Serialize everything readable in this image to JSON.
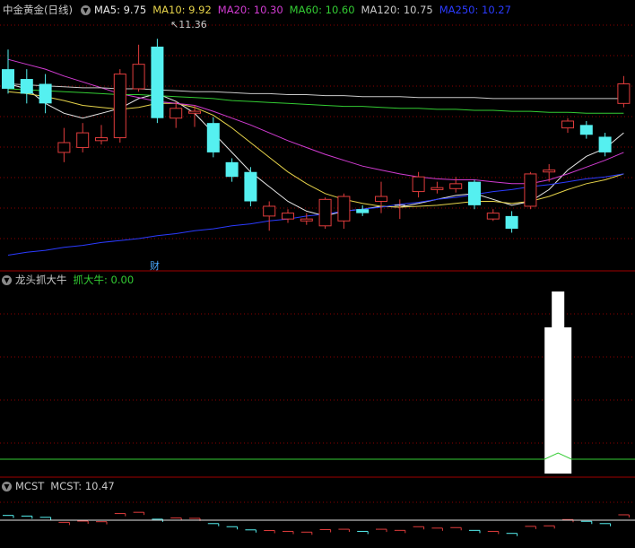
{
  "main_panel": {
    "title": "中金黄金(日线)",
    "ma_items": [
      {
        "label": "MA5: 9.75",
        "color": "#e8e8e8"
      },
      {
        "label": "MA10: 9.92",
        "color": "#e6d34a"
      },
      {
        "label": "MA20: 10.30",
        "color": "#d23cd2"
      },
      {
        "label": "MA60: 10.60",
        "color": "#33cc33"
      },
      {
        "label": "MA120: 10.75",
        "color": "#c8c8c8"
      },
      {
        "label": "MA250: 10.27",
        "color": "#2b3bff"
      }
    ],
    "max_price_label": "11.36",
    "marker_label": "财"
  },
  "indicator_panel": {
    "title": "龙头抓大牛",
    "value_label": "抓大牛: 0.00",
    "value_color": "#33cc33"
  },
  "mcst_panel": {
    "title": "MCST",
    "value_label": "MCST: 10.47"
  },
  "colors": {
    "up": "#e03c3c",
    "down": "#55f0f0",
    "grid": "#8b0000",
    "divider": "#a00000"
  },
  "chart_data": {
    "type": "candlestick",
    "price_axis_approx": [
      9.1,
      11.5
    ],
    "candles": [
      {
        "o": 11.05,
        "c": 10.85,
        "h": 11.25,
        "l": 10.8
      },
      {
        "o": 10.95,
        "c": 10.8,
        "h": 11.05,
        "l": 10.7
      },
      {
        "o": 10.9,
        "c": 10.7,
        "h": 11.0,
        "l": 10.6
      },
      {
        "o": 10.2,
        "c": 10.3,
        "h": 10.45,
        "l": 10.1
      },
      {
        "o": 10.25,
        "c": 10.4,
        "h": 10.5,
        "l": 10.2
      },
      {
        "o": 10.32,
        "c": 10.35,
        "h": 10.48,
        "l": 10.28
      },
      {
        "o": 10.35,
        "c": 11.0,
        "h": 11.05,
        "l": 10.3
      },
      {
        "o": 10.85,
        "c": 11.1,
        "h": 11.3,
        "l": 10.82
      },
      {
        "o": 11.28,
        "c": 10.55,
        "h": 11.36,
        "l": 10.5
      },
      {
        "o": 10.55,
        "c": 10.65,
        "h": 10.72,
        "l": 10.45
      },
      {
        "o": 10.6,
        "c": 10.62,
        "h": 10.68,
        "l": 10.46
      },
      {
        "o": 10.5,
        "c": 10.2,
        "h": 10.56,
        "l": 10.15
      },
      {
        "o": 10.1,
        "c": 9.95,
        "h": 10.14,
        "l": 9.9
      },
      {
        "o": 10.0,
        "c": 9.7,
        "h": 10.05,
        "l": 9.65
      },
      {
        "o": 9.55,
        "c": 9.65,
        "h": 9.7,
        "l": 9.4
      },
      {
        "o": 9.52,
        "c": 9.58,
        "h": 9.62,
        "l": 9.48
      },
      {
        "o": 9.5,
        "c": 9.52,
        "h": 9.58,
        "l": 9.46
      },
      {
        "o": 9.45,
        "c": 9.72,
        "h": 9.74,
        "l": 9.42
      },
      {
        "o": 9.5,
        "c": 9.75,
        "h": 9.78,
        "l": 9.42
      },
      {
        "o": 9.62,
        "c": 9.58,
        "h": 9.66,
        "l": 9.55
      },
      {
        "o": 9.7,
        "c": 9.75,
        "h": 9.9,
        "l": 9.58
      },
      {
        "o": 9.65,
        "c": 9.66,
        "h": 9.72,
        "l": 9.52
      },
      {
        "o": 9.8,
        "c": 9.95,
        "h": 10.0,
        "l": 9.74
      },
      {
        "o": 9.82,
        "c": 9.84,
        "h": 9.9,
        "l": 9.78
      },
      {
        "o": 9.83,
        "c": 9.88,
        "h": 9.95,
        "l": 9.79
      },
      {
        "o": 9.9,
        "c": 9.66,
        "h": 9.92,
        "l": 9.62
      },
      {
        "o": 9.52,
        "c": 9.58,
        "h": 9.62,
        "l": 9.5
      },
      {
        "o": 9.55,
        "c": 9.42,
        "h": 9.6,
        "l": 9.38
      },
      {
        "o": 9.65,
        "c": 9.98,
        "h": 10.0,
        "l": 9.62
      },
      {
        "o": 10.0,
        "c": 10.02,
        "h": 10.08,
        "l": 9.9
      },
      {
        "o": 10.45,
        "c": 10.52,
        "h": 10.55,
        "l": 10.4
      },
      {
        "o": 10.48,
        "c": 10.38,
        "h": 10.52,
        "l": 10.34
      },
      {
        "o": 10.36,
        "c": 10.2,
        "h": 10.4,
        "l": 10.16
      },
      {
        "o": 10.7,
        "c": 10.9,
        "h": 10.98,
        "l": 10.66
      }
    ],
    "ma_lines": {
      "ma5": [
        10.9,
        10.85,
        10.7,
        10.6,
        10.55,
        10.6,
        10.65,
        10.75,
        10.8,
        10.72,
        10.6,
        10.4,
        10.2,
        10.0,
        9.85,
        9.7,
        9.6,
        9.55,
        9.6,
        9.62,
        9.65,
        9.64,
        9.68,
        9.72,
        9.76,
        9.78,
        9.72,
        9.66,
        9.7,
        9.82,
        10.02,
        10.16,
        10.24,
        10.4
      ],
      "ma10": [
        10.82,
        10.8,
        10.77,
        10.73,
        10.68,
        10.66,
        10.64,
        10.66,
        10.7,
        10.7,
        10.66,
        10.58,
        10.45,
        10.3,
        10.15,
        10.0,
        9.88,
        9.78,
        9.72,
        9.68,
        9.65,
        9.64,
        9.65,
        9.66,
        9.68,
        9.7,
        9.7,
        9.68,
        9.7,
        9.75,
        9.82,
        9.88,
        9.92,
        9.98
      ],
      "ma20": [
        11.15,
        11.1,
        11.05,
        10.98,
        10.92,
        10.86,
        10.8,
        10.76,
        10.72,
        10.7,
        10.68,
        10.62,
        10.55,
        10.48,
        10.4,
        10.32,
        10.25,
        10.18,
        10.12,
        10.06,
        10.02,
        9.98,
        9.95,
        9.93,
        9.92,
        9.92,
        9.9,
        9.88,
        9.88,
        9.92,
        9.98,
        10.05,
        10.12,
        10.2
      ],
      "ma60": [
        10.85,
        10.84,
        10.83,
        10.82,
        10.81,
        10.8,
        10.79,
        10.79,
        10.78,
        10.77,
        10.76,
        10.75,
        10.73,
        10.72,
        10.71,
        10.7,
        10.69,
        10.68,
        10.67,
        10.67,
        10.66,
        10.65,
        10.65,
        10.64,
        10.64,
        10.63,
        10.63,
        10.62,
        10.62,
        10.61,
        10.61,
        10.6,
        10.6,
        10.6
      ],
      "ma120": [
        10.9,
        10.89,
        10.88,
        10.87,
        10.86,
        10.86,
        10.85,
        10.85,
        10.84,
        10.83,
        10.82,
        10.82,
        10.81,
        10.8,
        10.8,
        10.79,
        10.79,
        10.78,
        10.78,
        10.77,
        10.77,
        10.77,
        10.76,
        10.76,
        10.76,
        10.76,
        10.75,
        10.75,
        10.75,
        10.75,
        10.75,
        10.75,
        10.75,
        10.75
      ],
      "ma250": [
        9.15,
        9.18,
        9.2,
        9.23,
        9.25,
        9.28,
        9.3,
        9.32,
        9.35,
        9.37,
        9.4,
        9.42,
        9.45,
        9.47,
        9.5,
        9.52,
        9.55,
        9.57,
        9.6,
        9.62,
        9.64,
        9.67,
        9.69,
        9.72,
        9.74,
        9.77,
        9.8,
        9.82,
        9.85,
        9.87,
        9.9,
        9.93,
        9.95,
        9.98
      ]
    },
    "signal_bar_index": 29,
    "signal_bar_height": 1.0,
    "mcst_line_value": 10.47
  }
}
